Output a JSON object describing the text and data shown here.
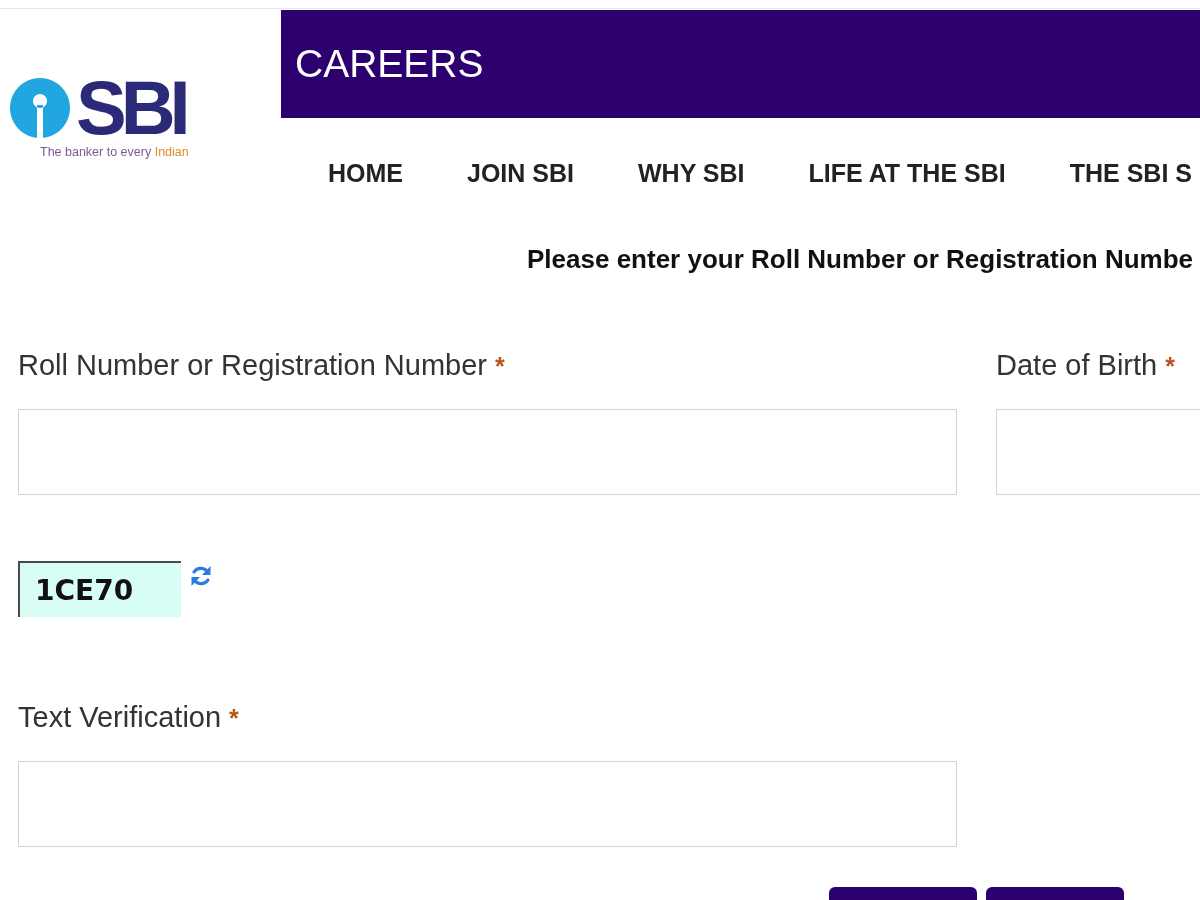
{
  "logo": {
    "name": "SBI",
    "tagline": "The banker to every",
    "tagline_highlight": "Indian"
  },
  "header": {
    "title": "CAREERS"
  },
  "nav": [
    "HOME",
    "JOIN SBI",
    "WHY SBI",
    "LIFE AT THE SBI",
    "THE SBI S"
  ],
  "instruction": "Please enter your Roll Number or Registration Numbe",
  "fields_row": [
    {
      "label": "Roll Number or Registration Number",
      "required_mark": "*"
    },
    {
      "label": "Date of Birth",
      "required_mark": "*"
    }
  ],
  "captcha": {
    "code": "1CE70"
  },
  "verification_field": {
    "label": "Text Verification",
    "required_mark": "*"
  },
  "buttons": [
    {
      "kind": "primary"
    },
    {
      "kind": "primary"
    }
  ]
}
